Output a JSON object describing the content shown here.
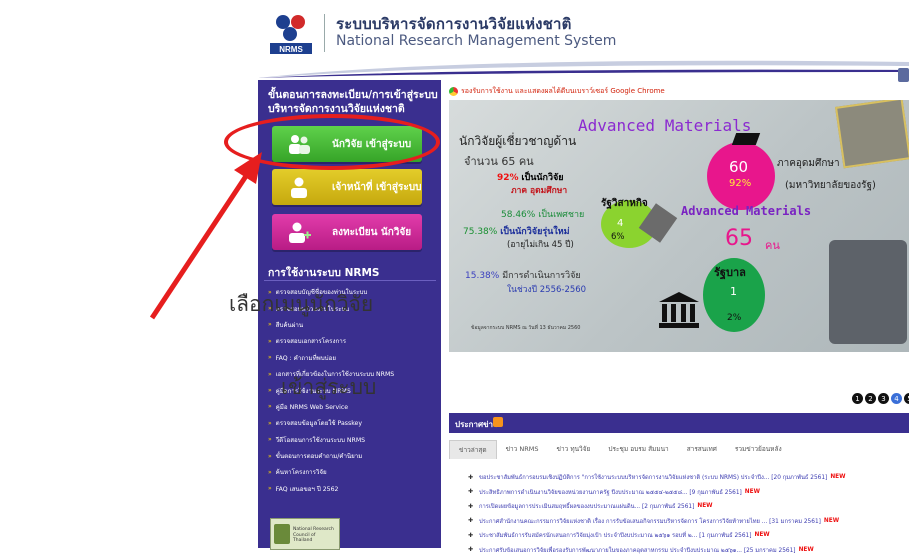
{
  "header": {
    "logo_text": "NRMS",
    "title_th": "ระบบบริหารจัดการงานวิจัยแห่งชาติ",
    "title_en": "National Research Management System"
  },
  "sidebar": {
    "steps_heading": "ขั้นตอนการลงทะเบียน/การเข้าสู่ระบบบริหารจัดการงานวิจัยแห่งชาติ",
    "buttons": [
      {
        "label": "นักวิจัย เข้าสู่ระบบ",
        "color": "#3fb52f"
      },
      {
        "label": "เจ้าหน้าที่ เข้าสู่ระบบ",
        "color": "#d4b81a"
      },
      {
        "label": "ลงทะเบียน นักวิจัย",
        "color": "#c9279a"
      }
    ],
    "usage_heading": "การใช้งานระบบ NRMS",
    "menu": [
      "ตรวจสอบบัญชีชื่อของท่านในระบบ",
      "ตรวจสอบหน่วยงานในระบบ",
      "สืบค้นผ่าน",
      "ตรวจสอบเอกสารโครงการ",
      "FAQ : คำถามที่พบบ่อย",
      "เอกสารที่เกี่ยวข้องในการใช้งานระบบ NRMS",
      "คู่มือการใช้งานระบบ NRMS",
      "คู่มือ NRMS Web Service",
      "ตรวจสอบข้อมูลโดยใช้ Passkey",
      "วีดีโอสอนการใช้งานระบบ NRMS",
      "ขั้นตอนการตอบคำถาม/คำนิยาม",
      "ค้นหาโครงการวิจัย",
      "FAQ เสนอขอฯ ปี 2562"
    ],
    "bottom_logo_text": "National Research Council of Thailand",
    "accent_color": "#3a2f8f"
  },
  "annotation": {
    "line1": "เลือกเมนูนักวิจัย",
    "line2": "เข้าสู่ระบบ",
    "color": "#e61e1e"
  },
  "main": {
    "chrome_note": "รองรับการใช้งาน และแสดงผลได้ดีบนเบราว์เซอร์ Google Chrome",
    "banner": {
      "headline": "Advanced Materials",
      "expert_label": "นักวิจัยผู้เชี่ยวชาญด้าน",
      "count": "จำนวน 65 คน",
      "pct_researcher": "92%",
      "pct_researcher_label": "เป็นนักวิจัย",
      "sector_label": "ภาค อุดมศึกษา",
      "pct_male": "58.46%",
      "male_label": "เป็นเพศชาย",
      "pct_young": "75.38%",
      "young_label": "เป็นนักวิจัยรุ่นใหม่",
      "young_sub": "(อายุไม่เกิน 45 ปี)",
      "pct_exec": "15.38%",
      "exec_label": "มีการดำเนินการวิจัย",
      "exec_sub": "ในช่วงปี 2556-2560",
      "uni_num": "60",
      "uni_pct": "92%",
      "uni_label1": "ภาคอุดมศึกษา",
      "uni_label2": "(มหาวิทยาลัยของรัฐ)",
      "state_label": "รัฐวิสาหกิจ",
      "state_num": "4",
      "state_pct": "6%",
      "gov_label": "รัฐบาล",
      "gov_num": "1",
      "gov_pct": "2%",
      "total_label": "Advanced Materials",
      "total_num": "65",
      "total_unit": "คน",
      "footnote": "ข้อมูลจากระบบ NRMS ณ วันที่ 13 ธันวาคม 2560"
    },
    "slider_dots": [
      "1",
      "2",
      "3",
      "4",
      "5"
    ],
    "news_heading": "ประกาศข่าว",
    "tabs": [
      "ข่าวล่าสุด",
      "ข่าว NRMS",
      "ข่าว ทุนวิจัย",
      "ประชุม อบรม สัมมนา",
      "สารสนเทศ",
      "รวมข่าวย้อนหลัง"
    ],
    "news": [
      {
        "text": "ขอประชาสัมพันธ์การอบรมเชิงปฏิบัติการ \"การใช้งานระบบบริหารจัดการงานวิจัยแห่งชาติ (ระบบ NRMS) ประจำปีง... [20 กุมภาพันธ์ 2561]",
        "new": "NEW"
      },
      {
        "text": "ประสิทธิภาพการดำเนินงานวิจัยของหน่วยงานภาครัฐ ปีงบประมาณ ๒๕๕๔-๒๕๕๘... [9 กุมภาพันธ์ 2561]",
        "new": "NEW"
      },
      {
        "text": "การเปิดเผยข้อมูลการประเมินสมฤทธิ์ผลของงบประมาณแผ่นดิน... [2 กุมภาพันธ์ 2561]",
        "new": "NEW"
      },
      {
        "text": "ประกาศสำนักงานคณะกรรมการวิจัยแห่งชาติ เรื่อง การรับข้อเสนอกิจกรรมบริหารจัดการ โครงการวิจัยท้าทายไทย ... [31 มกราคม 2561]",
        "new": "NEW"
      },
      {
        "text": "ประชาสัมพันธ์การรับสมัครนักเสนอการวิจัยมุ่งเป้า ประจำปีงบประมาณ ๒๕๖๑ รอบที่ ๒... [1 กุมภาพันธ์ 2561]",
        "new": "NEW"
      },
      {
        "text": "ประกาศรับข้อเสนอการวิจัยเพื่อรองรับการพัฒนาภายในของภาคอุตสาหกรรม ประจำปีงบประมาณ ๒๕๖๑... [25 มกราคม 2561]",
        "new": "NEW"
      }
    ]
  }
}
